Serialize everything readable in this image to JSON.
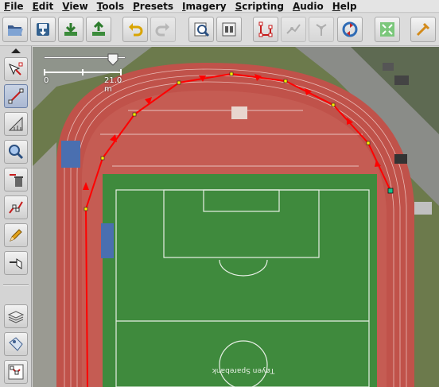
{
  "menu": [
    {
      "label": "File",
      "key": "F",
      "rest": "ile"
    },
    {
      "label": "Edit",
      "key": "E",
      "rest": "dit"
    },
    {
      "label": "View",
      "key": "V",
      "rest": "iew"
    },
    {
      "label": "Tools",
      "key": "T",
      "rest": "ools"
    },
    {
      "label": "Presets",
      "key": "P",
      "rest": "resets"
    },
    {
      "label": "Imagery",
      "key": "I",
      "rest": "magery"
    },
    {
      "label": "Scripting",
      "key": "S",
      "rest": "cripting"
    },
    {
      "label": "Audio",
      "key": "A",
      "rest": "udio"
    },
    {
      "label": "Help",
      "key": "H",
      "rest": "elp"
    }
  ],
  "toolbar": [
    {
      "name": "open-icon",
      "enabled": true
    },
    {
      "name": "save-icon",
      "enabled": true
    },
    {
      "name": "download-icon",
      "enabled": true
    },
    {
      "name": "upload-icon",
      "enabled": true
    },
    {
      "name": "undo-icon",
      "enabled": true
    },
    {
      "name": "redo-icon",
      "enabled": false
    },
    {
      "name": "preferences-icon",
      "enabled": true
    },
    {
      "name": "tag-editor-icon",
      "enabled": true
    },
    {
      "name": "select-all-icon",
      "enabled": true
    },
    {
      "name": "zoom-to-selection-icon",
      "enabled": false
    },
    {
      "name": "zoom-to-layer-icon",
      "enabled": false
    },
    {
      "name": "update-data-icon",
      "enabled": true
    },
    {
      "name": "fullscreen-icon",
      "enabled": true
    },
    {
      "name": "edit-layer-icon",
      "enabled": true
    }
  ],
  "left_tools": [
    {
      "name": "select-tool-icon",
      "active": false
    },
    {
      "name": "draw-nodes-tool-icon",
      "active": true
    },
    {
      "name": "measure-tool-icon",
      "active": false
    },
    {
      "name": "zoom-tool-icon",
      "active": false
    },
    {
      "name": "delete-tool-icon",
      "active": false
    },
    {
      "name": "improve-way-tool-icon",
      "active": false
    },
    {
      "name": "draw-pencil-tool-icon",
      "active": false
    },
    {
      "name": "parallel-tool-icon",
      "active": false
    }
  ],
  "left_panels": [
    {
      "name": "layers-panel-icon"
    },
    {
      "name": "tags-panel-icon"
    },
    {
      "name": "selection-panel-icon"
    }
  ],
  "scale": {
    "start_label": "0",
    "end_label": "21.0 m"
  },
  "stadium_text": "Tøyen Sparebank",
  "colors": {
    "track": "#c0524a",
    "grass": "#3f8a3d",
    "way": "#ff0000",
    "node": "#ffee00",
    "selected_node": "#17c08a"
  }
}
